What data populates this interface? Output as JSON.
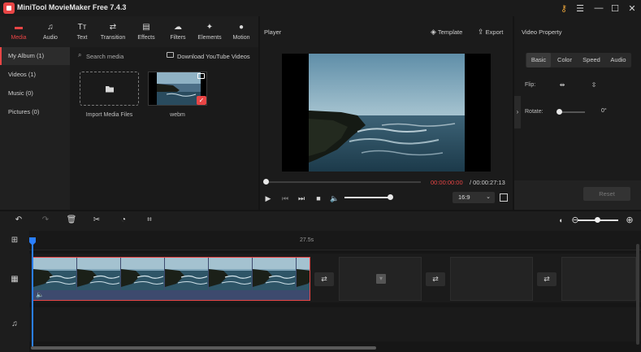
{
  "app": {
    "title": "MiniTool MovieMaker Free 7.4.3"
  },
  "nav": [
    {
      "label": "Media",
      "icon": "folder-icon",
      "glyph": "▬"
    },
    {
      "label": "Audio",
      "icon": "music-icon",
      "glyph": "♫"
    },
    {
      "label": "Text",
      "icon": "text-icon",
      "glyph": "Tт"
    },
    {
      "label": "Transition",
      "icon": "transition-icon",
      "glyph": "⇄"
    },
    {
      "label": "Effects",
      "icon": "effects-icon",
      "glyph": "▤"
    },
    {
      "label": "Filters",
      "icon": "filters-icon",
      "glyph": "☁"
    },
    {
      "label": "Elements",
      "icon": "elements-icon",
      "glyph": "✦"
    },
    {
      "label": "Motion",
      "icon": "motion-icon",
      "glyph": "●"
    }
  ],
  "album": {
    "items": [
      "My Album (1)",
      "Videos (1)",
      "Music (0)",
      "Pictures (0)"
    ]
  },
  "media": {
    "search_placeholder": "Search media",
    "download_label": "Download YouTube Videos",
    "import_label": "Import Media Files",
    "file_label": "webm"
  },
  "player": {
    "label": "Player",
    "template_label": "Template",
    "export_label": "Export",
    "time_current": "00:00:00:00",
    "time_total": "/ 00:00:27:13",
    "aspect_ratio": "16:9",
    "seek_fraction": 0,
    "volume_fraction": 1
  },
  "properties": {
    "title": "Video Property",
    "tabs": [
      "Basic",
      "Color",
      "Speed",
      "Audio"
    ],
    "flip_label": "Flip:",
    "rotate_label": "Rotate:",
    "rotate_value": "0°",
    "reset_label": "Reset"
  },
  "timeline": {
    "ruler_time": "27.5s"
  },
  "colors": {
    "accent": "#e84545",
    "playhead": "#2a7fff",
    "clip_fill": "#3d4a6e"
  }
}
